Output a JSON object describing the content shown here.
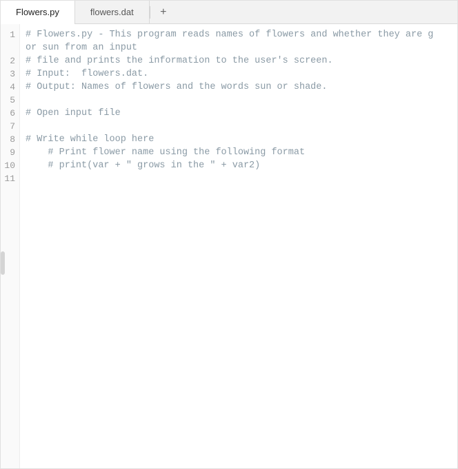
{
  "tabs": {
    "items": [
      {
        "label": "Flowers.py",
        "active": true
      },
      {
        "label": "flowers.dat",
        "active": false
      }
    ],
    "add_icon": "+"
  },
  "editor": {
    "lines": [
      {
        "n": "1",
        "text": "# Flowers.py - This program reads names of flowers and whether they are g",
        "cls": "cm"
      },
      {
        "n": "",
        "text": "or sun from an input",
        "cls": "cm",
        "wrap": true
      },
      {
        "n": "2",
        "text": "# file and prints the information to the user's screen.",
        "cls": "cm"
      },
      {
        "n": "3",
        "text": "# Input:  flowers.dat.",
        "cls": "cm"
      },
      {
        "n": "4",
        "text": "# Output: Names of flowers and the words sun or shade.",
        "cls": "cm"
      },
      {
        "n": "5",
        "text": "",
        "cls": ""
      },
      {
        "n": "6",
        "text": "# Open input file",
        "cls": "cm"
      },
      {
        "n": "7",
        "text": "",
        "cls": ""
      },
      {
        "n": "8",
        "text": "# Write while loop here",
        "cls": "cm"
      },
      {
        "n": "9",
        "text": "    # Print flower name using the following format",
        "cls": "cm"
      },
      {
        "n": "10",
        "text": "    # print(var + \" grows in the \" + var2)",
        "cls": "cm"
      },
      {
        "n": "11",
        "text": "",
        "cls": ""
      }
    ]
  }
}
